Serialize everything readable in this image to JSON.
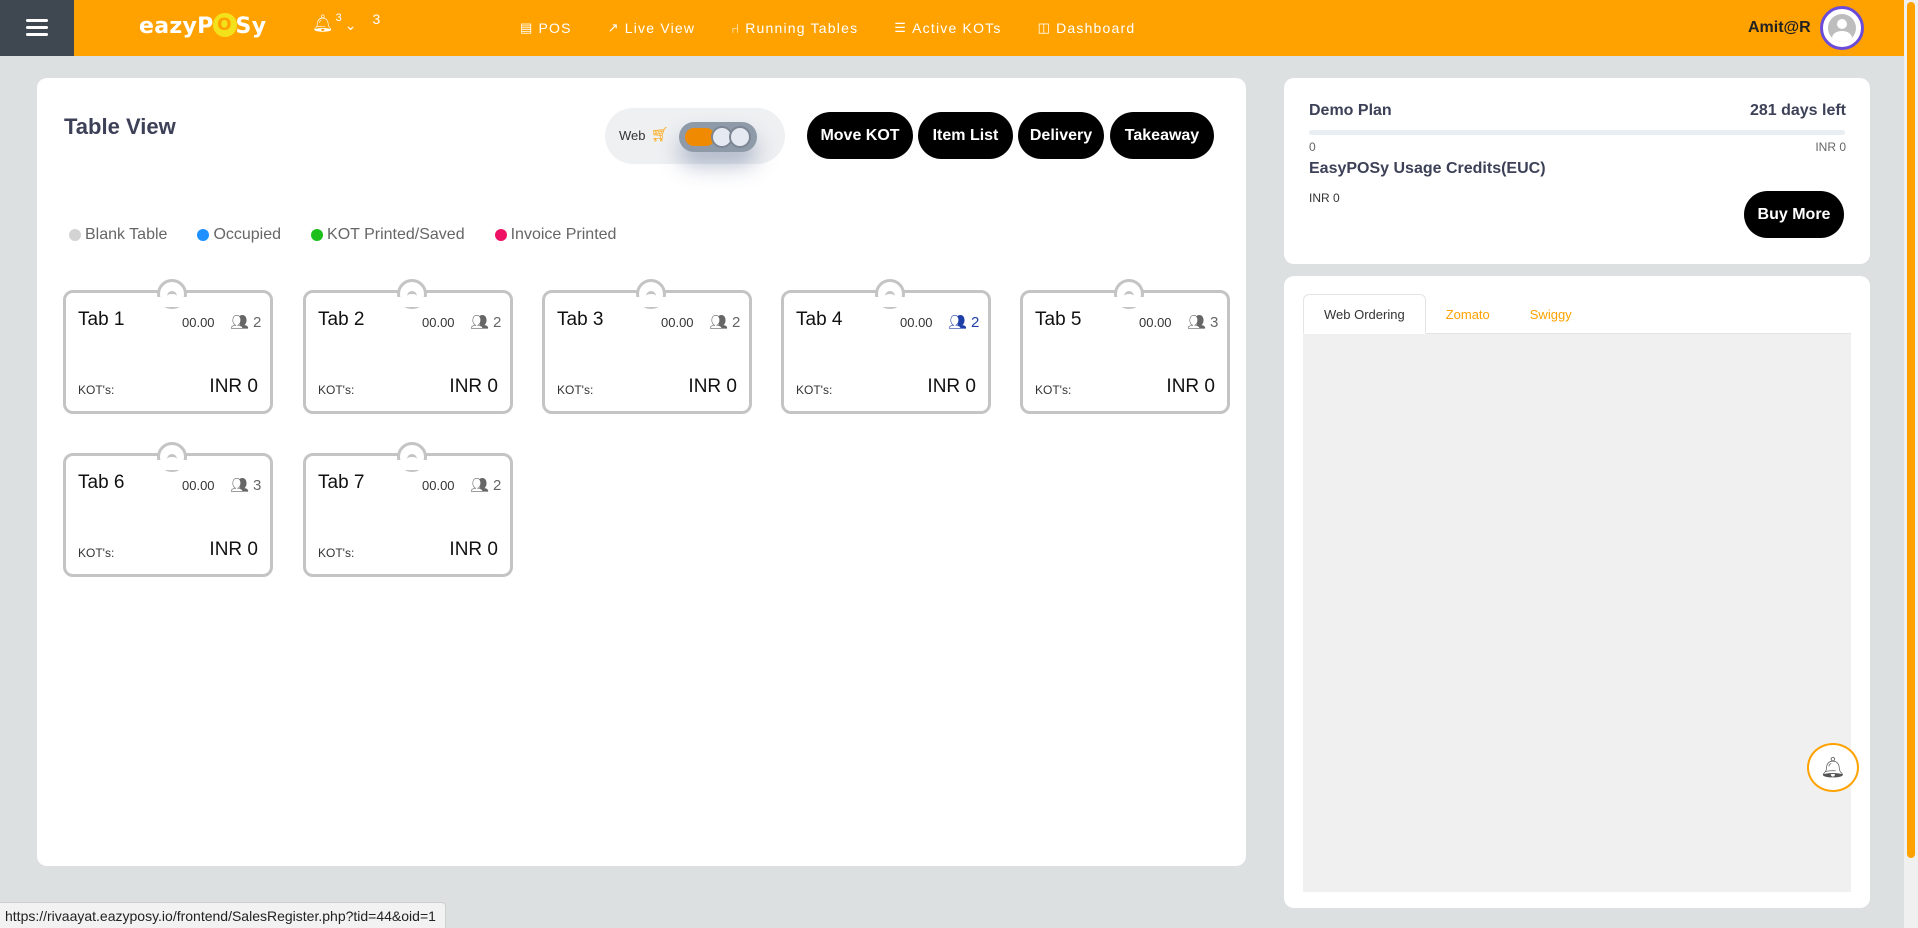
{
  "header": {
    "logo_text_pre": "eazyP",
    "logo_text_o": "O",
    "logo_text_post": "Sy",
    "notif_superscript": "3",
    "notif_count": "3",
    "nav": [
      {
        "label": "POS",
        "icon": "receipt-icon"
      },
      {
        "label": "Live View",
        "icon": "trend-up-icon"
      },
      {
        "label": "Running Tables",
        "icon": "chair-icon"
      },
      {
        "label": "Active KOTs",
        "icon": "list-icon"
      },
      {
        "label": "Dashboard",
        "icon": "columns-icon"
      }
    ],
    "user": "Amit@R"
  },
  "main": {
    "title": "Table View",
    "web_toggle_label": "Web",
    "buttons": {
      "move_kot": "Move KOT",
      "item_list": "Item List",
      "delivery": "Delivery",
      "takeaway": "Takeaway"
    },
    "legend": [
      {
        "label": "Blank Table",
        "color": "#d3d3d3"
      },
      {
        "label": "Occupied",
        "color": "#1e90ff"
      },
      {
        "label": "KOT Printed/Saved",
        "color": "#1cbf1c"
      },
      {
        "label": "Invoice Printed",
        "color": "#ee1166"
      }
    ],
    "tables": [
      {
        "name": "Tab 1",
        "amount": "00.00",
        "guests": "2",
        "kot_label": "KOT's:",
        "total": "INR 0"
      },
      {
        "name": "Tab 2",
        "amount": "00.00",
        "guests": "2",
        "kot_label": "KOT's:",
        "total": "INR 0"
      },
      {
        "name": "Tab 3",
        "amount": "00.00",
        "guests": "2",
        "kot_label": "KOT's:",
        "total": "INR 0"
      },
      {
        "name": "Tab 4",
        "amount": "00.00",
        "guests": "2",
        "kot_label": "KOT's:",
        "total": "INR 0"
      },
      {
        "name": "Tab 5",
        "amount": "00.00",
        "guests": "3",
        "kot_label": "KOT's:",
        "total": "INR 0"
      },
      {
        "name": "Tab 6",
        "amount": "00.00",
        "guests": "3",
        "kot_label": "KOT's:",
        "total": "INR 0"
      },
      {
        "name": "Tab 7",
        "amount": "00.00",
        "guests": "2",
        "kot_label": "KOT's:",
        "total": "INR 0"
      }
    ]
  },
  "plan": {
    "name": "Demo Plan",
    "days_left": "281 days left",
    "progress_min": "0",
    "progress_max": "INR 0",
    "progress_fraction": 0,
    "euc_title": "EasyPOSy Usage Credits(EUC)",
    "euc_value": "INR 0",
    "buy_more": "Buy More"
  },
  "ordering": {
    "tabs": [
      "Web Ordering",
      "Zomato",
      "Swiggy"
    ]
  },
  "status_url": "https://rivaayat.eazyposy.io/frontend/SalesRegister.php?tid=44&oid=1",
  "colors": {
    "accent": "#ffa200",
    "button": "#000000",
    "active_guest": "#1e3ea8"
  }
}
